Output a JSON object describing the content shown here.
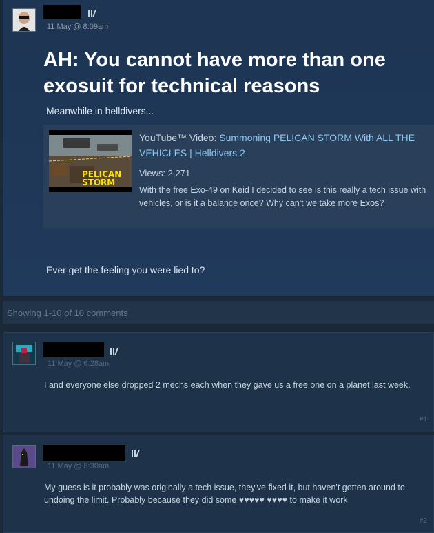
{
  "post": {
    "timestamp": "11 May @ 8:09am",
    "title": "AH: You cannot have more than one exosuit for technical reasons",
    "intro": "Meanwhile in helldivers...",
    "outro": "Ever get the feeling you were lied to?",
    "embed": {
      "prefix": "YouTube™ Video: ",
      "video_title": "Summoning PELICAN STORM With ALL THE VEHICLES | Helldivers 2",
      "views": "Views: 2,271",
      "description": "With the free Exo-49 on Keid I decided to see is this really a tech issue with vehicles, or is it a balance once? Why can't we take more Exos?",
      "thumb_text_line1": "PELICAN",
      "thumb_text_line2": "STORM"
    }
  },
  "comments_header": "Showing 1-10 of 10 comments",
  "comments": [
    {
      "timestamp": "11 May @ 6:28am",
      "text": "I and everyone else dropped 2 mechs each when they gave us a free one on a planet last week.",
      "number": "#1"
    },
    {
      "timestamp": "11 May @ 8:30am",
      "text": "My guess is it probably was originally a tech issue, they've fixed it, but haven't gotten around to undoing the limit. Probably because they did some ♥♥♥♥♥ ♥♥♥♥ to make it work",
      "number": "#2"
    }
  ],
  "colors": {
    "background": "#1b2838",
    "link": "#8ec8f0",
    "title": "#ffffff",
    "redaction": "#000000"
  }
}
